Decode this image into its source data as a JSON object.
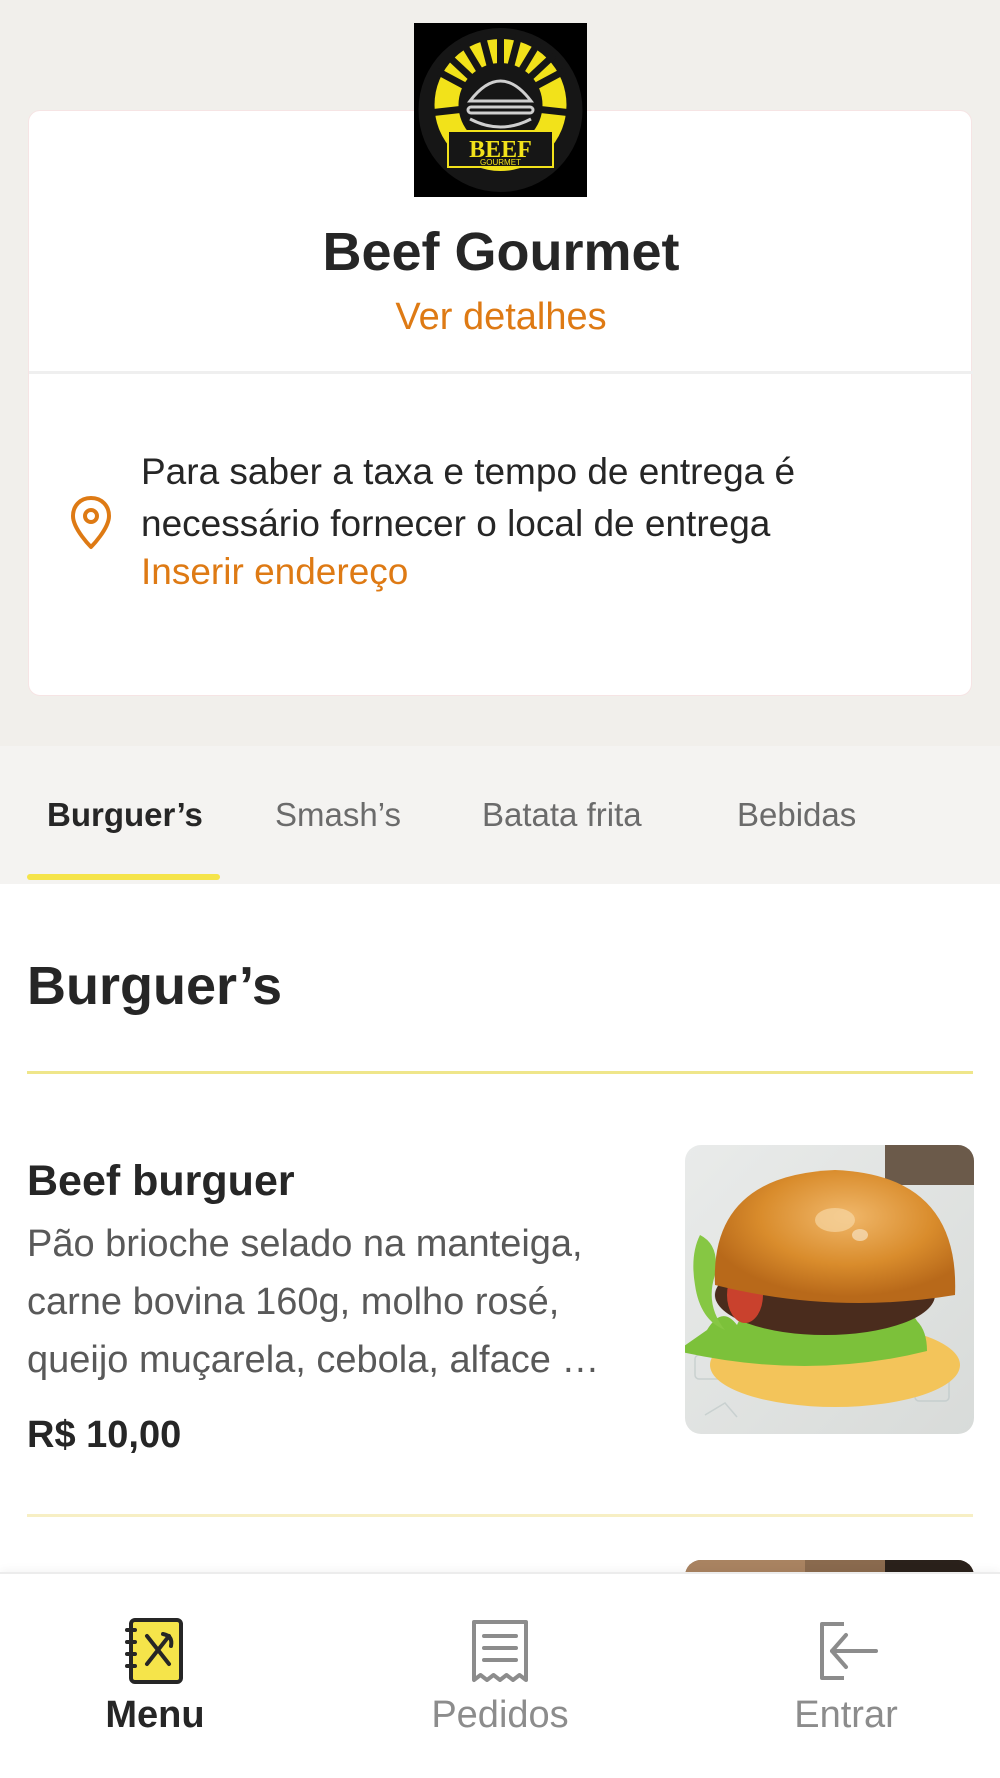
{
  "store": {
    "name": "Beef Gourmet",
    "details_link": "Ver detalhes",
    "logo_text": "BEEF",
    "logo_subtext": "GOURMET"
  },
  "delivery": {
    "message": "Para saber a taxa e tempo de entrega é necessário fornecer o local de entrega",
    "address_link": "Inserir endereço"
  },
  "tabs": [
    {
      "label": "Burguer’s",
      "active": true
    },
    {
      "label": "Smash’s",
      "active": false
    },
    {
      "label": "Batata frita",
      "active": false
    },
    {
      "label": "Bebidas",
      "active": false
    }
  ],
  "section": {
    "title": "Burguer’s"
  },
  "products": [
    {
      "name": "Beef burguer",
      "description": "Pão brioche selado na manteiga, carne bovina 160g, molho rosé, queijo muçarela, cebola, alface …",
      "price": "R$ 10,00"
    }
  ],
  "bottom_nav": [
    {
      "label": "Menu",
      "icon": "menu-book-icon",
      "active": true
    },
    {
      "label": "Pedidos",
      "icon": "receipt-icon",
      "active": false
    },
    {
      "label": "Entrar",
      "icon": "login-icon",
      "active": false
    }
  ],
  "colors": {
    "accent_orange": "#de7a14",
    "accent_yellow": "#f5e44a",
    "header_bg": "#f1efeb"
  }
}
